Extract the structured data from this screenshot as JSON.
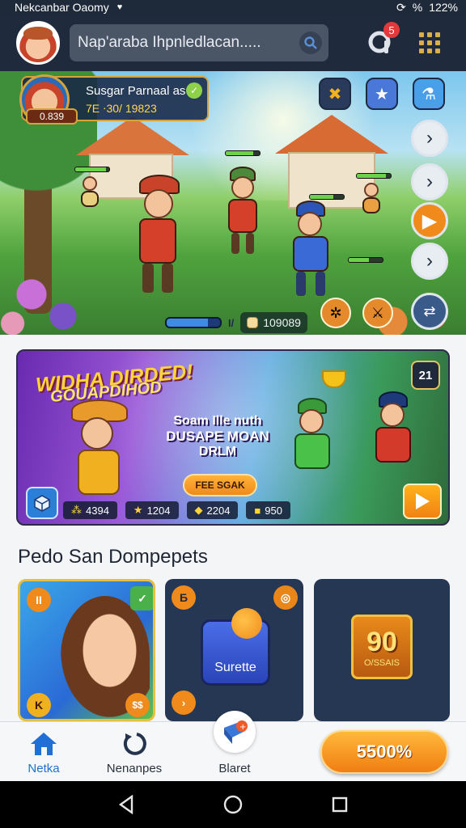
{
  "status_bar": {
    "title": "Nekcanbar Oaomy",
    "battery": "122%",
    "signal": "%"
  },
  "header": {
    "search_placeholder": "Nap'araba Ihpnledlacan.....",
    "notification_count": "5"
  },
  "scene": {
    "player": {
      "name": "Susgar Parnaal as",
      "level": "7E ⋅30/ 19823",
      "score": "0.839"
    },
    "energy_text": "I/",
    "energy_fraction": 0.78,
    "coins": "109089"
  },
  "promo": {
    "title_line1": "WIDHA DIRDED!",
    "title_line2": "GOUAPDIHOD",
    "text_line1": "Soam Ille nuth",
    "text_line2": "DUSAPE MOAN",
    "text_line3": "DRLM",
    "cta_label": "FEE SGAK",
    "count": "21",
    "stats": [
      {
        "icon": "⁂",
        "value": "4394"
      },
      {
        "icon": "★",
        "value": "1204"
      },
      {
        "icon": "◆",
        "value": "2204"
      },
      {
        "icon": "■",
        "value": "950"
      }
    ]
  },
  "section": {
    "title": "Pedo San Dompepets",
    "cards": [
      {
        "top_badge": "II",
        "bottom_badge": "K",
        "bottom_right": "$$"
      },
      {
        "top_badge": "Б",
        "label": "Surette"
      },
      {
        "big": "90",
        "small": "O/SSAIS"
      }
    ]
  },
  "bottom_nav": {
    "items": [
      {
        "label": "Netka"
      },
      {
        "label": "Nenanpes"
      },
      {
        "label": "Blaret"
      }
    ],
    "action_label": "5500%"
  },
  "colors": {
    "accent": "#f08a1a",
    "primary": "#1f6fd6",
    "header_bg": "#1f2b3c"
  }
}
